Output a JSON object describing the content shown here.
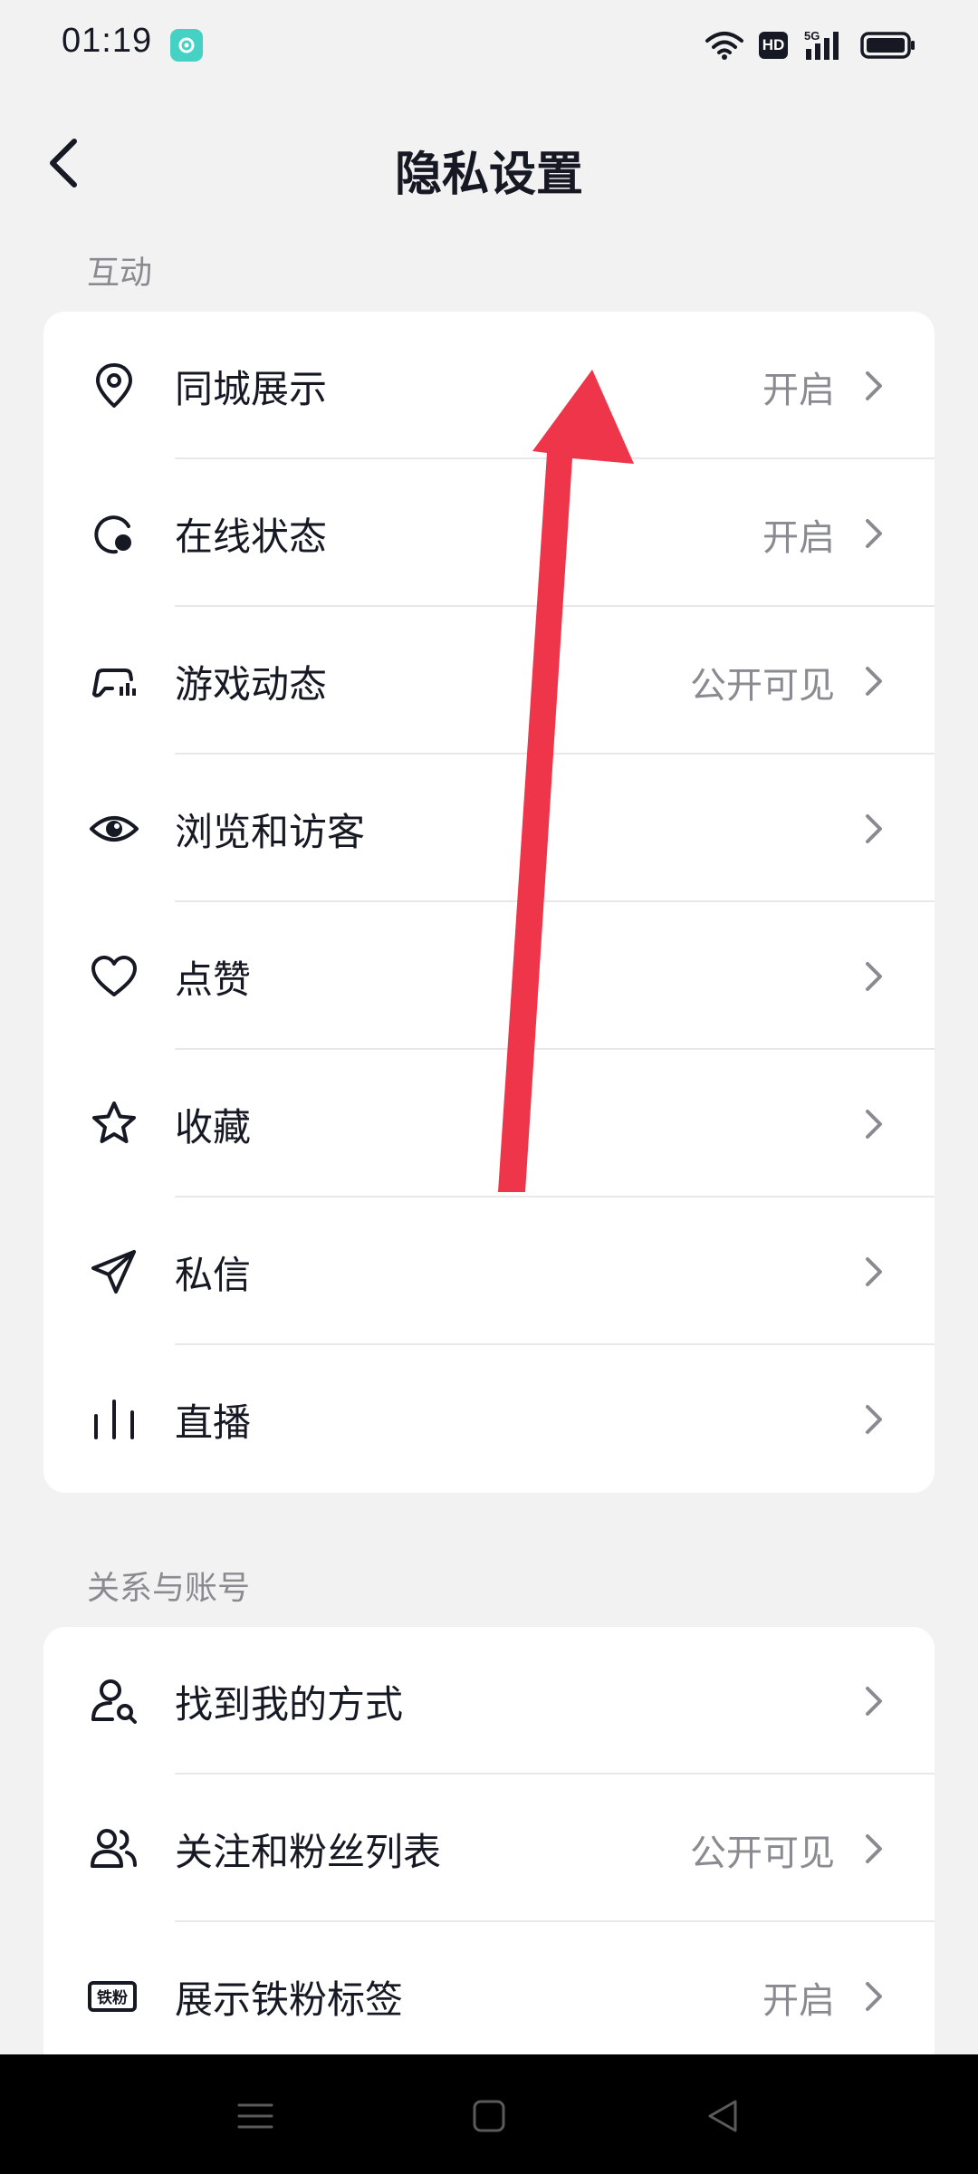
{
  "status_bar": {
    "time": "01:19",
    "hd_badge": "HD",
    "network": "5G"
  },
  "nav": {
    "title": "隐私设置"
  },
  "sections": [
    {
      "title": "互动",
      "items": [
        {
          "label": "同城展示",
          "value": "开启",
          "icon": "location-pin-icon"
        },
        {
          "label": "在线状态",
          "value": "开启",
          "icon": "online-status-icon"
        },
        {
          "label": "游戏动态",
          "value": "公开可见",
          "icon": "game-controller-icon"
        },
        {
          "label": "浏览和访客",
          "value": "",
          "icon": "eye-icon"
        },
        {
          "label": "点赞",
          "value": "",
          "icon": "heart-icon"
        },
        {
          "label": "收藏",
          "value": "",
          "icon": "star-icon"
        },
        {
          "label": "私信",
          "value": "",
          "icon": "paper-plane-icon"
        },
        {
          "label": "直播",
          "value": "",
          "icon": "live-bars-icon"
        }
      ]
    },
    {
      "title": "关系与账号",
      "items": [
        {
          "label": "找到我的方式",
          "value": "",
          "icon": "user-search-icon"
        },
        {
          "label": "关注和粉丝列表",
          "value": "公开可见",
          "icon": "users-icon"
        },
        {
          "label": "展示铁粉标签",
          "value": "开启",
          "icon": "fan-badge-icon",
          "badge_text": "铁粉"
        }
      ]
    }
  ],
  "colors": {
    "background": "#f2f2f2",
    "card": "#ffffff",
    "text": "#161823",
    "secondary": "#8a8b91",
    "arrow": "#ee3549"
  }
}
